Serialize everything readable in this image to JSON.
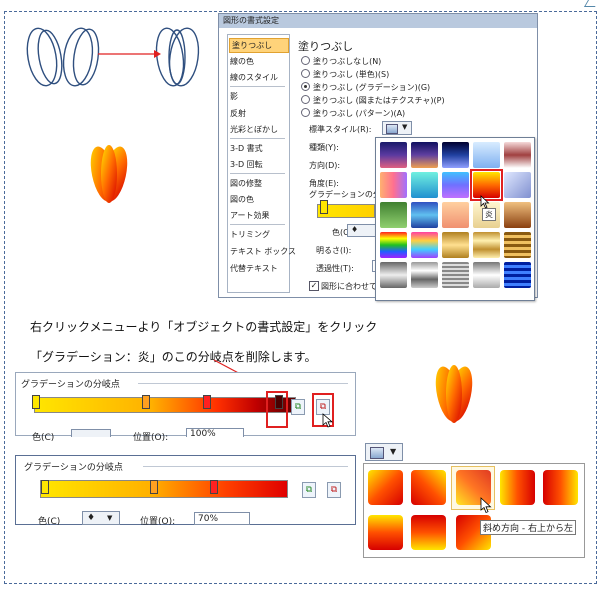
{
  "dialog": {
    "title": "図形の書式設定",
    "sidebar": [
      "塗りつぶし",
      "線の色",
      "線のスタイル",
      "影",
      "反射",
      "光彩とぼかし",
      "3-D 書式",
      "3-D 回転",
      "図の修整",
      "図の色",
      "アート効果",
      "トリミング",
      "テキスト ボックス",
      "代替テキスト"
    ],
    "heading": "塗りつぶし",
    "radios": [
      "塗りつぶしなし(N)",
      "塗りつぶし (単色)(S)",
      "塗りつぶし (グラデーション)(G)",
      "塗りつぶし (図またはテクスチャ)(P)",
      "塗りつぶし (パターン)(A)"
    ],
    "selected_radio_index": 2,
    "preset_label": "標準スタイル(R):",
    "type_label": "種類(Y):",
    "direction_label": "方向(D):",
    "angle_label": "角度(E):",
    "stops_label": "グラデーションの分岐",
    "color_label": "色(C)",
    "brightness_label": "明るさ(I):",
    "transparency_label": "透過性(T):",
    "rotate_checkbox": "図形に合わせて回",
    "preset_tooltip": "炎"
  },
  "caption": {
    "line1": "右クリックメニューより「オブジェクトの書式設定」をクリック",
    "line2": "「グラデーション：炎」のこの分岐点を削除します。"
  },
  "stops_panel_1": {
    "title": "グラデーションの分岐点",
    "color_label": "色(C)",
    "position_label": "位置(O):",
    "position_value": "100%"
  },
  "stops_panel_2": {
    "title": "グラデーションの分岐点",
    "color_label": "色(C)",
    "position_label": "位置(O):",
    "position_value": "70%"
  },
  "direction_gallery": {
    "tooltip": "斜め方向 - 右上から左"
  },
  "colors": {
    "accent_red": "#e02020",
    "selection_orange": "#ffd37a"
  }
}
